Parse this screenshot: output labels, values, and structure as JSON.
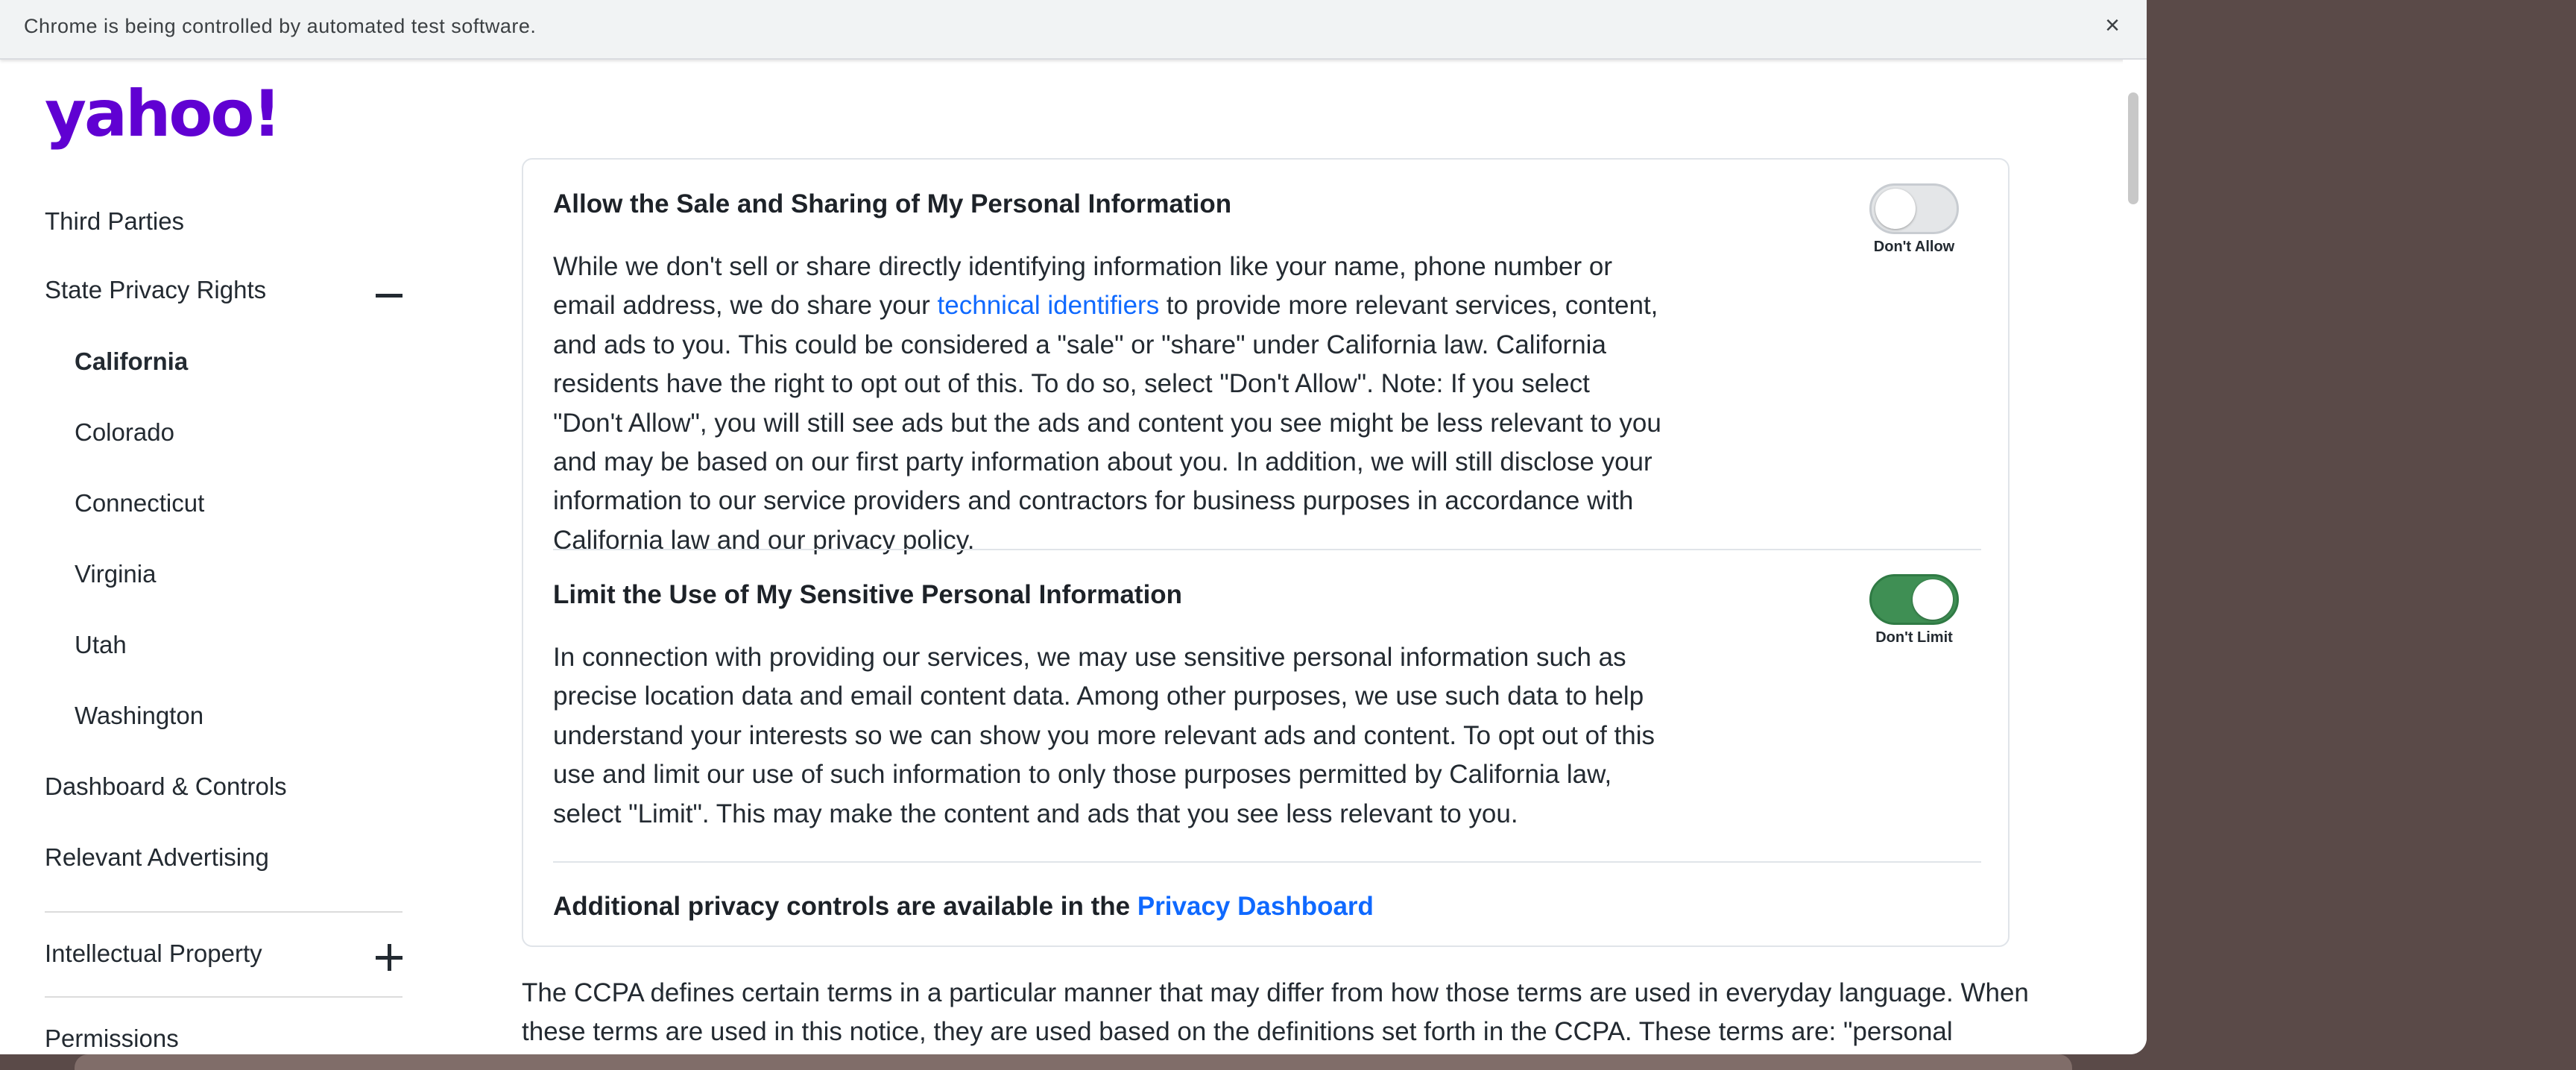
{
  "automation_bar": {
    "message": "Chrome is being controlled by automated test software.",
    "close": "×"
  },
  "logo": {
    "text": "yahoo!",
    "color": "#6001d2"
  },
  "sidebar": {
    "third_parties": "Third Parties",
    "state_privacy_rights": "State Privacy Rights",
    "states": [
      "California",
      "Colorado",
      "Connecticut",
      "Virginia",
      "Utah",
      "Washington"
    ],
    "active_state": "California",
    "dashboard_controls": "Dashboard & Controls",
    "relevant_advertising": "Relevant Advertising",
    "intellectual_property": "Intellectual Property",
    "permissions": "Permissions"
  },
  "card": {
    "sale": {
      "title": "Allow the Sale and Sharing of My Personal Information",
      "text_before_link": "While we don't sell or share directly identifying information like your name, phone number or email address, we do share your ",
      "link": "technical identifiers",
      "text_after_link": " to provide more relevant services, content, and ads to you. This could be considered a \"sale\" or \"share\" under California law. California residents have the right to opt out of this. To do so, select \"Don't Allow\". Note: If you select \"Don't Allow\", you will still see ads but the ads and content you see might be less relevant to you and may be based on our first party information about you. In addition, we will still disclose your information to our service providers and contractors for business purposes in accordance with California law and our privacy policy.",
      "toggle_label": "Don't Allow",
      "toggle_on": false
    },
    "sensitive": {
      "title": "Limit the Use of My Sensitive Personal Information",
      "text": "In connection with providing our services, we may use sensitive personal information such as precise location data and email content data. Among other purposes, we use such data to help understand your interests so we can show you more relevant ads and content. To opt out of this use and limit our use of such information to only those purposes permitted by California law, select \"Limit\". This may make the content and ads that you see less relevant to you.",
      "toggle_label": "Don't Limit",
      "toggle_on": true
    },
    "additional": {
      "text": "Additional privacy controls are available in the ",
      "link": "Privacy Dashboard"
    }
  },
  "bottom_text": "The CCPA defines certain terms in a particular manner that may differ from how those terms are used in everyday language. When these terms are used in this notice, they are used based on the definitions set forth in the CCPA. These terms are: \"personal information\",",
  "colors": {
    "link": "#0f69ff",
    "toggle_on": "#3f8f54",
    "toggle_off": "#e4e6e8"
  }
}
